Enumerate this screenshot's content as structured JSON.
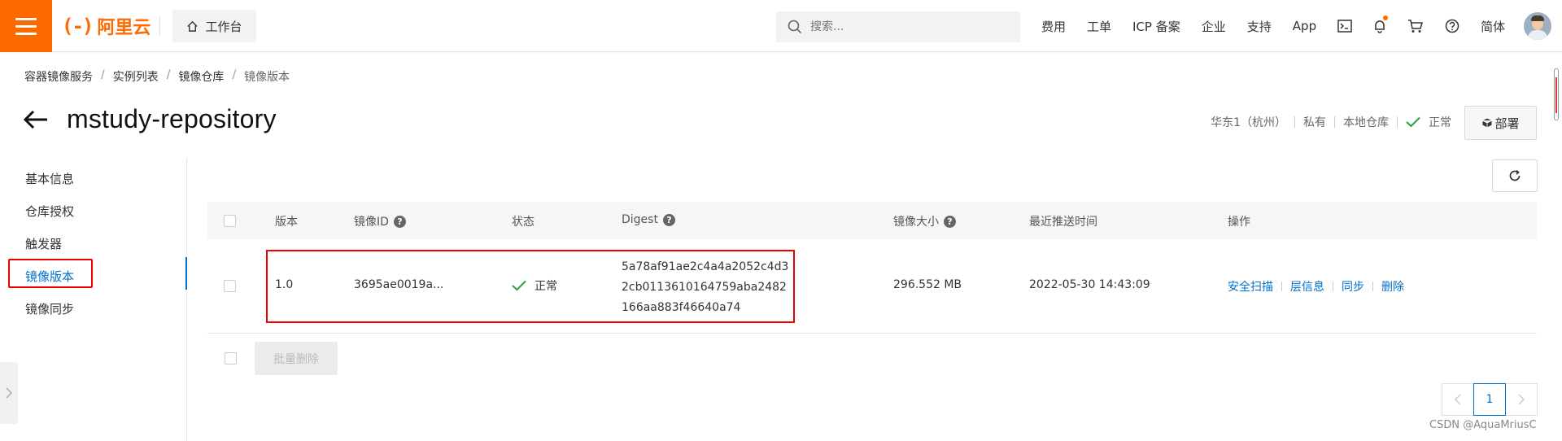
{
  "topbar": {
    "logo_text": "阿里云",
    "workbench_label": "工作台",
    "search_placeholder": "搜索...",
    "nav_items": [
      "费用",
      "工单",
      "ICP 备案",
      "企业",
      "支持",
      "App"
    ],
    "lang_label": "简体"
  },
  "breadcrumb": [
    "容器镜像服务",
    "实例列表",
    "镜像仓库",
    "镜像版本"
  ],
  "page": {
    "title": "mstudy-repository",
    "region": "华东1（杭州）",
    "visibility": "私有",
    "repo_type": "本地仓库",
    "status": "正常",
    "deploy_label": "部署"
  },
  "sidenav": {
    "items": [
      "基本信息",
      "仓库授权",
      "触发器",
      "镜像版本",
      "镜像同步"
    ],
    "active_index": 3
  },
  "table": {
    "headers": {
      "version": "版本",
      "image_id": "镜像ID",
      "status": "状态",
      "digest": "Digest",
      "size": "镜像大小",
      "pushed": "最近推送时间",
      "actions": "操作"
    },
    "rows": [
      {
        "version": "1.0",
        "image_id": "3695ae0019a...",
        "status": "正常",
        "digest": "5a78af91ae2c4a4a2052c4d32cb0113610164759aba2482166aa883f46640a74",
        "size": "296.552 MB",
        "pushed": "2022-05-30 14:43:09",
        "actions": [
          "安全扫描",
          "层信息",
          "同步",
          "删除"
        ]
      }
    ]
  },
  "batch_delete_label": "批量删除",
  "pagination": {
    "current": "1"
  },
  "watermark": "CSDN @AquaMriusC",
  "colors": {
    "brand": "#ff6a00",
    "link": "#0070cc",
    "success": "#23a33a",
    "highlight": "#e00000"
  }
}
